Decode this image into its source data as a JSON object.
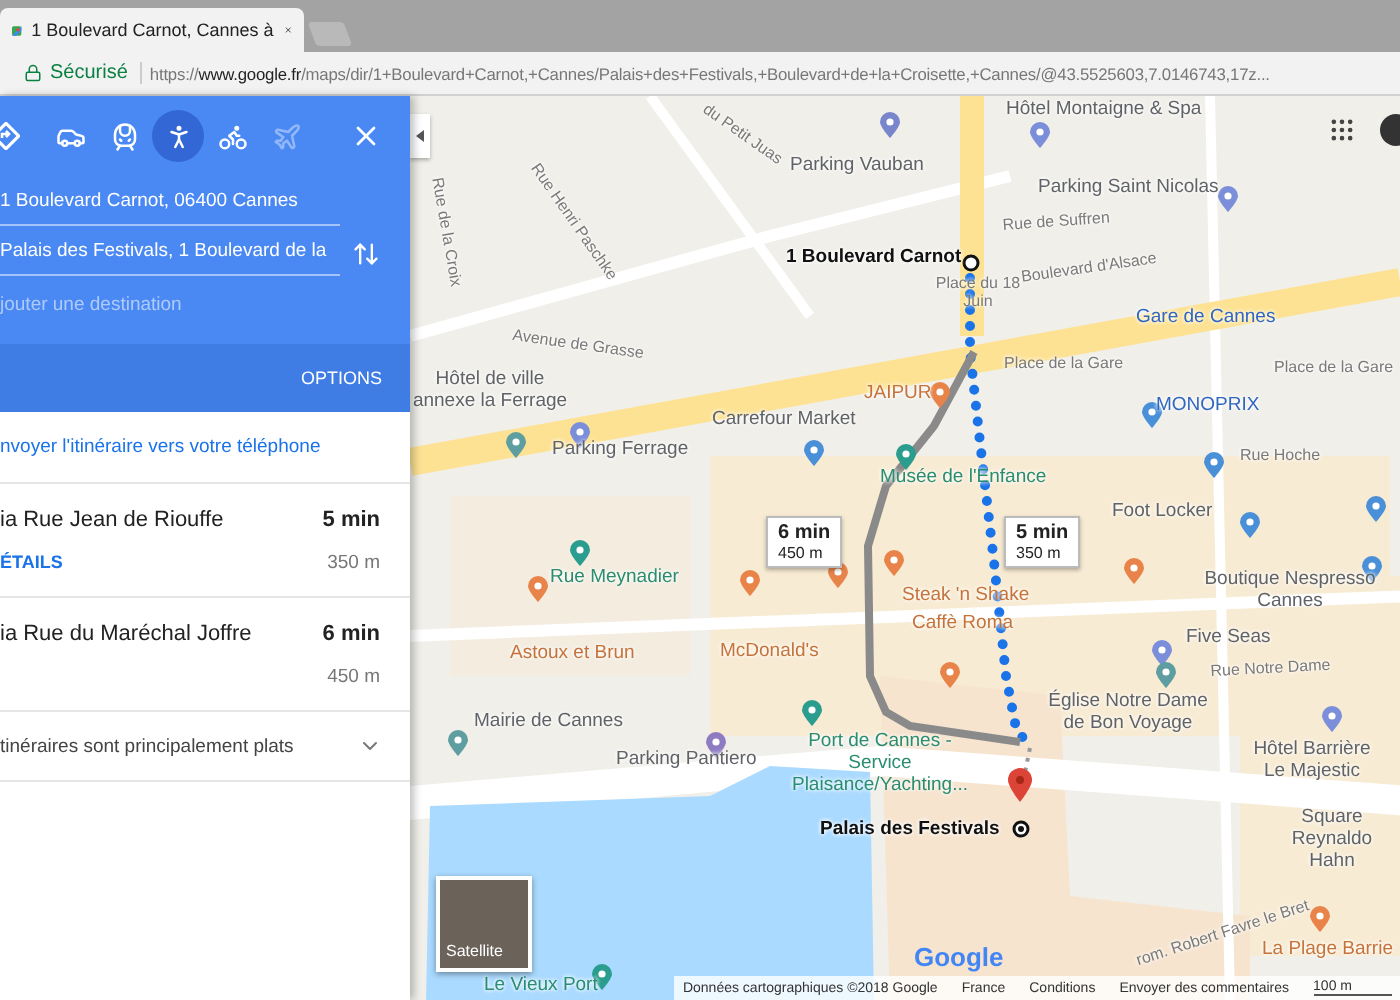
{
  "browser": {
    "tab_title": "1 Boulevard Carnot, Cannes à",
    "secure_label": "Sécurisé",
    "url": "https://**www.google.fr**/maps/dir/1+Boulevard+Carnot,+Cannes/Palais+des+Festivals,+Boulevard+de+la+Croisette,+Cannes/@43.5525603,7.0146743,17z..."
  },
  "directions": {
    "modes": [
      {
        "kind": "directions",
        "selected": false,
        "disabled": false
      },
      {
        "kind": "car",
        "selected": false,
        "disabled": false
      },
      {
        "kind": "transit",
        "selected": false,
        "disabled": false
      },
      {
        "kind": "walk",
        "selected": true,
        "disabled": false
      },
      {
        "kind": "bike",
        "selected": false,
        "disabled": false
      },
      {
        "kind": "flight",
        "selected": false,
        "disabled": true
      }
    ],
    "origin": "1 Boulevard Carnot, 06400 Cannes",
    "destination": "Palais des Festivals, 1 Boulevard de la",
    "add_placeholder": "jouter une destination",
    "options_label": "OPTIONS",
    "send_link": "nvoyer l'itinéraire vers votre téléphone",
    "routes": [
      {
        "via": "ia Rue Jean de Riouffe",
        "time": "5 min",
        "distance": "350 m",
        "details_link": "ÉTAILS",
        "selected": true
      },
      {
        "via": "ia Rue du Maréchal Joffre",
        "time": "6 min",
        "distance": "450 m",
        "selected": false
      }
    ],
    "note": {
      "text": "tinéraires sont principalement plats",
      "expanded": false
    }
  },
  "map": {
    "labels": [
      {
        "text": "du Petit Juas",
        "kind": "street"
      },
      {
        "text": "Hôtel Montaigne & Spa",
        "kind": "poi"
      },
      {
        "text": "Parking Vauban",
        "kind": "poi"
      },
      {
        "text": "Parking Saint Nicolas",
        "kind": "poi"
      },
      {
        "text": "Rue Henri Paschke",
        "kind": "street"
      },
      {
        "text": "Rue de la Croix",
        "kind": "street"
      },
      {
        "text": "Rue de Suffren",
        "kind": "street"
      },
      {
        "text": "1 Boulevard Carnot",
        "kind": "endpoint"
      },
      {
        "text": "Boulevard d'Alsace",
        "kind": "street"
      },
      {
        "text": "Place du 18 Juin",
        "kind": "street"
      },
      {
        "text": "Avenue de Grasse",
        "kind": "street"
      },
      {
        "text": "Gare de Cannes",
        "kind": "transit"
      },
      {
        "text": "Place de la Gare",
        "kind": "street"
      },
      {
        "text": "Place de la Gare",
        "kind": "street"
      },
      {
        "text": "Hôtel de ville annexe la Ferrage",
        "kind": "poi"
      },
      {
        "text": "JAIPUR",
        "kind": "food"
      },
      {
        "text": "MONOPRIX",
        "kind": "shop"
      },
      {
        "text": "Carrefour Market",
        "kind": "poi"
      },
      {
        "text": "Parking Ferrage",
        "kind": "poi"
      },
      {
        "text": "Rue Hoche",
        "kind": "street"
      },
      {
        "text": "Musée de l'Enfance",
        "kind": "leisure"
      },
      {
        "text": "Foot Locker",
        "kind": "poi"
      },
      {
        "text": "Rue Meynadier",
        "kind": "leisure"
      },
      {
        "text": "Steak 'n Shake",
        "kind": "food"
      },
      {
        "text": "Caffè Roma",
        "kind": "food"
      },
      {
        "text": "Boutique Nespresso Cannes",
        "kind": "poi"
      },
      {
        "text": "Five Seas",
        "kind": "poi"
      },
      {
        "text": "Astoux et Brun",
        "kind": "food"
      },
      {
        "text": "McDonald's",
        "kind": "food"
      },
      {
        "text": "Rue Notre Dame",
        "kind": "street"
      },
      {
        "text": "Mairie de Cannes",
        "kind": "poi"
      },
      {
        "text": "Église Notre Dame de Bon Voyage",
        "kind": "poi"
      },
      {
        "text": "Parking Pantiero",
        "kind": "poi"
      },
      {
        "text": "Port de Cannes - Service Plaisance/Yachting...",
        "kind": "leisure"
      },
      {
        "text": "Hôtel Barrière Le Majestic",
        "kind": "poi"
      },
      {
        "text": "Palais des Festivals",
        "kind": "endpoint"
      },
      {
        "text": "Square Reynaldo Hahn",
        "kind": "poi"
      },
      {
        "text": "rom. Robert Favre le Bret",
        "kind": "street"
      },
      {
        "text": "La Plage Barrie",
        "kind": "food"
      },
      {
        "text": "Le Vieux Port",
        "kind": "leisure"
      }
    ],
    "callouts": [
      {
        "time": "6 min",
        "distance": "450 m"
      },
      {
        "time": "5 min",
        "distance": "350 m"
      }
    ],
    "satellite_label": "Satellite",
    "logo": "Google",
    "footer": [
      "Données cartographiques ©2018 Google",
      "France",
      "Conditions",
      "Envoyer des commentaires"
    ],
    "scale": "100 m"
  }
}
